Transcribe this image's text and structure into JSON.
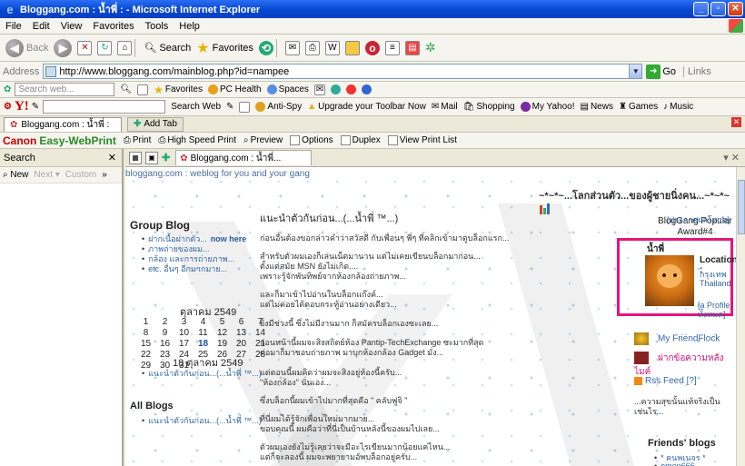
{
  "window": {
    "title": "Bloggang.com : น้ำพี่ : - Microsoft Internet Explorer"
  },
  "menu": [
    "File",
    "Edit",
    "View",
    "Favorites",
    "Tools",
    "Help"
  ],
  "nav": {
    "back": "Back",
    "search": "Search",
    "favorites": "Favorites"
  },
  "address": {
    "label": "Address",
    "url": "http://www.bloggang.com/mainblog.php?id=nampee",
    "go": "Go",
    "links": "Links"
  },
  "toolbar1": {
    "search_placeholder": "Search web...",
    "favorites": "Favorites",
    "pchealth": "PC Health",
    "spaces": "Spaces"
  },
  "toolbar2": {
    "search_web": "Search Web",
    "antispy": "Anti-Spy",
    "upgrade": "Upgrade your Toolbar Now",
    "mail": "Mail",
    "shopping": "Shopping",
    "myyahoo": "My Yahoo!",
    "news": "News",
    "games": "Games",
    "music": "Music"
  },
  "tabs": {
    "current": "Bloggang.com : น้ำพี่ :",
    "add": "Add Tab"
  },
  "canon": {
    "brand": "Canon",
    "product": "Easy-WebPrint",
    "print": "Print",
    "hsprint": "High Speed Print",
    "preview": "Preview",
    "options": "Options",
    "duplex": "Duplex",
    "viewlist": "View Print List"
  },
  "searchpane": {
    "title": "Search",
    "new": "New",
    "next": "Next",
    "custom": "Custom"
  },
  "pagetab": {
    "label": "Bloggang.com : น้ำพี่..."
  },
  "content": {
    "header": "bloggang.com : weblog for you and your gang",
    "banner": "~*~*~...โลกส่วนตัว...ของผู้ชายนิ่งคน...~*~*~",
    "groupblog": {
      "title": "Group Blog",
      "items": [
        "ฝากเนื้อฝากตัว...",
        "ภาพถ่ายของผม...",
        "กล้อง และการถ่ายภาพ...",
        "etc. อื่นๆ อีกมากมาย..."
      ],
      "new_label": "now here"
    },
    "calendar": {
      "title": "ตุลาคม 2549",
      "weeks": [
        [
          "1",
          "2",
          "3",
          "4",
          "5",
          "6",
          "7"
        ],
        [
          "8",
          "9",
          "10",
          "11",
          "12",
          "13",
          "14"
        ],
        [
          "15",
          "16",
          "17",
          "18",
          "19",
          "20",
          "21"
        ],
        [
          "22",
          "23",
          "24",
          "25",
          "26",
          "27",
          "28"
        ],
        [
          "29",
          "30",
          "31",
          "",
          "",
          "",
          ""
        ]
      ],
      "today": "18"
    },
    "date18": {
      "title": "18 ตุลาคม 2549",
      "item": "แนะนำตัวกันก่อน...(...น้ำพี่ ™...)"
    },
    "allblogs": {
      "title": "All Blogs",
      "item": "แนะนำตัวกันก่อน...(...น้ำพี่ ™...)"
    },
    "post": {
      "title": "แนะนำตัวกันก่อน...(...น้ำพี่ ™...)",
      "paragraphs": [
        "ก่อนอื่นต้องขอกล่าวคำว่าสวัสดี กับเพื่อนๆ พี่ๆ ที่คลิกเข้ามาดูบล็อกแรก...",
        "สำหรับตัวผมเองก็เล่นเน็ตมานาน แต่ไม่เคยเขียนบล็อกมาก่อน...",
        "ตั้งแต่สมัย MSN ยังไม่เกิด....",
        "เพราะรู้จักพันทิพย์จากห้องกล้องถ่ายภาพ...",
        "และก็มาเข้าไปอ่านในบล็อกแก๊งค์...",
        "แต่ไม่ค่อยได้ตอบกระทู้อ่านอย่างเดียว...",
        "ยิ่งมีช่วงนี้ ซึ่งไม่มีงานมาก ก็สมัครบล็อกเองซะเลย...",
        "ก่อนหน้านี้ผมจะสิงสถิตย์ห้อง Pantip-TechExchange ซะมากที่สุด",
        "ต่อมาก็มาชอบถ่ายภาพ มาบุกห้องกล้อง Gadget มั่ง...",
        "แต่ตอนนี้ผมคิดว่าผมจะสิงอยู่ห้องนี้ครับ...",
        "\"ห้องกล้อง\" นั่นเอง...",
        "ซึ่งบล็อกนี้ผมเข้าไปมากที่สุดคือ \" คลับฟูจิ \"",
        "ที่นี่ผมได้รู้จักเพื่อนใหม่มากมาย...",
        "ขอบคุณนี้ ผมคือว่าที่นี่เป็นบ้านหลังนี้ของผมไปเลย...",
        "ตัวผมเองยังไม่รู้เลยว่าจะมีอะไรเขียนมากน้อยแค่ไหน...",
        "แต่ก็จะลองนี้ ผมจะพยายามอัพบล็อกอยู่ครับ..."
      ]
    },
    "right": {
      "award_title": "BlogGang Popular Award#4",
      "award_link": "[ประกาศผลโหวต]",
      "name": "น้ำพี่",
      "location_label": "Location :",
      "location1": "กรุงเทพ",
      "location2": "Thailand",
      "profile": "[a Profile ทั้งหมด]",
      "friendflock": "My FriendFlock",
      "leave_msg": "ฝากข้อความหลังไมค์",
      "rss": "Rss Feed [?]",
      "tagline": "...ความสุขนั้นแท้จริงเป็นเช่นไร...",
      "friends_title": "Friends' blogs",
      "friends": [
        "* คนพเนจร *",
        "omen666"
      ]
    }
  }
}
